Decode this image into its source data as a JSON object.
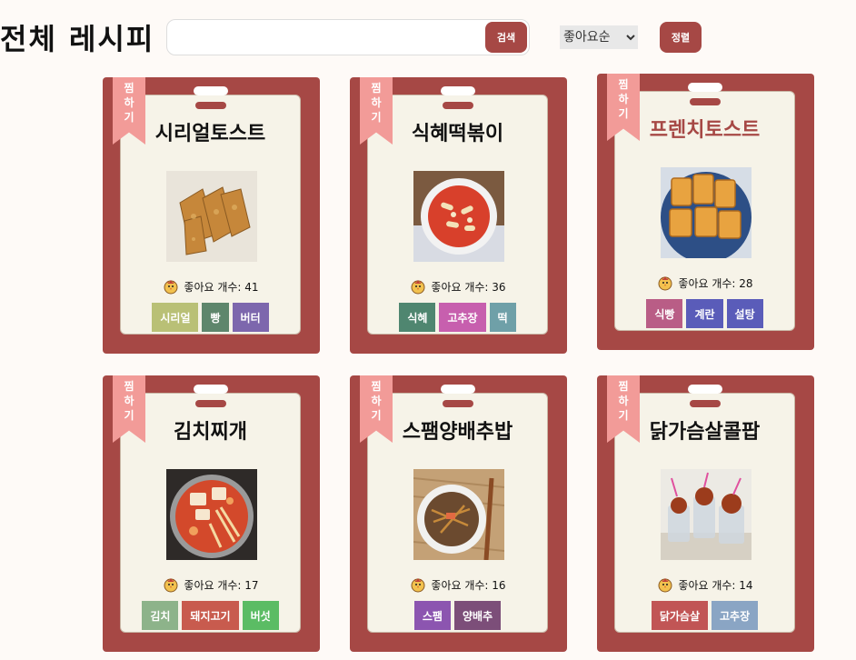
{
  "header": {
    "title": "전체 레시피",
    "search_value": "",
    "search_placeholder": "",
    "search_button": "검색",
    "sort_selected": "좋아요순",
    "sort_options": [
      "좋아요순"
    ],
    "sort_button": "정렬"
  },
  "colors": {
    "card": "#a64845",
    "bookmark": "#f29b98",
    "inner": "#f6f3e8",
    "button": "#a64845"
  },
  "bookmark_label": [
    "찜",
    "하",
    "기"
  ],
  "likes_prefix": "좋아요 개수: ",
  "cards": [
    {
      "title": "시리얼토스트",
      "likes_text": "좋아요 개수: 41",
      "likes": 41,
      "tags": [
        {
          "label": "시리얼",
          "color": "#b9c076"
        },
        {
          "label": "빵",
          "color": "#5e866c"
        },
        {
          "label": "버터",
          "color": "#7d67ad"
        }
      ],
      "photo": "fried-toast-icon"
    },
    {
      "title": "식혜떡볶이",
      "likes_text": "좋아요 개수: 36",
      "likes": 36,
      "tags": [
        {
          "label": "식혜",
          "color": "#4f8670"
        },
        {
          "label": "고추장",
          "color": "#c75fae"
        },
        {
          "label": "떡",
          "color": "#6fa0a8"
        }
      ],
      "photo": "tteokbokki-icon"
    },
    {
      "title": "프렌치토스트",
      "likes_text": "좋아요 개수: 28",
      "likes": 28,
      "highlighted": true,
      "tags": [
        {
          "label": "식빵",
          "color": "#b95d86"
        },
        {
          "label": "계란",
          "color": "#5a5cb9"
        },
        {
          "label": "설탕",
          "color": "#5a5cb9"
        }
      ],
      "photo": "french-toast-icon"
    },
    {
      "title": "김치찌개",
      "likes_text": "좋아요 개수: 17",
      "likes": 17,
      "tags": [
        {
          "label": "김치",
          "color": "#8db38a"
        },
        {
          "label": "돼지고기",
          "color": "#c85b4e"
        },
        {
          "label": "버섯",
          "color": "#5bbc64"
        }
      ],
      "photo": "kimchi-stew-icon"
    },
    {
      "title": "스팸양배추밥",
      "likes_text": "좋아요 개수: 16",
      "likes": 16,
      "tags": [
        {
          "label": "스팸",
          "color": "#8c55b0"
        },
        {
          "label": "양배추",
          "color": "#7c4e79"
        }
      ],
      "photo": "spam-cabbage-rice-icon"
    },
    {
      "title": "닭가슴살콜팝",
      "likes_text": "좋아요 개수: 14",
      "likes": 14,
      "tags": [
        {
          "label": "닭가슴살",
          "color": "#c15555"
        },
        {
          "label": "고추장",
          "color": "#8aa5c4"
        }
      ],
      "photo": "chicken-pop-icon"
    }
  ]
}
